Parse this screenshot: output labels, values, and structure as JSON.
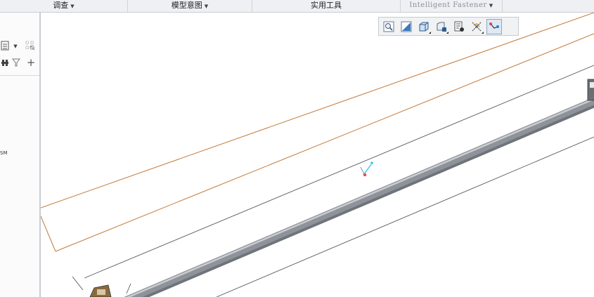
{
  "ribbon": {
    "groups": [
      {
        "label": "调查",
        "has_menu": true
      },
      {
        "label": "模型意图",
        "has_menu": true
      },
      {
        "label": "实用工具",
        "has_menu": false
      },
      {
        "label": "Intelligent Fastener",
        "has_menu": true
      }
    ]
  },
  "left_panel": {
    "icons": [
      "tree-view-icon",
      "dropdown-icon",
      "settings-grid-icon",
      "show-icon",
      "filter-icon",
      "add-icon"
    ],
    "tree_text": "SM"
  },
  "view_toolbar": {
    "buttons": [
      {
        "icon": "zoom-to-fit-icon",
        "active": false
      },
      {
        "icon": "repaint-icon",
        "active": false
      },
      {
        "icon": "display-style-icon",
        "active": false
      },
      {
        "icon": "saved-views-icon",
        "active": false
      },
      {
        "icon": "view-manager-icon",
        "active": false
      },
      {
        "icon": "datum-display-icon",
        "active": false
      },
      {
        "icon": "annotation-display-icon",
        "active": true
      }
    ]
  },
  "colors": {
    "sketch_line": "#c27a3a",
    "edge_line": "#555a60",
    "pipe_body": "#8e9299",
    "pipe_highlight": "#c9ccd1",
    "csys_cyan": "#2cc6e6",
    "csys_red": "#e24b4b"
  }
}
